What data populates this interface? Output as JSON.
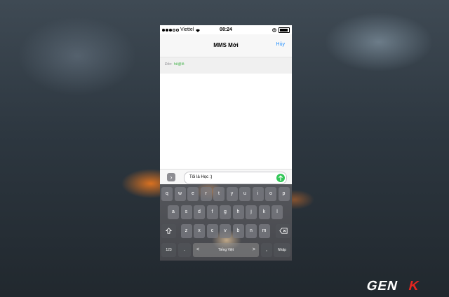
{
  "status_bar": {
    "carrier": "Viettel",
    "time": "08:24"
  },
  "nav": {
    "title": "MMS Mới",
    "cancel_label": "Hủy"
  },
  "recipient": {
    "label": "Đến:",
    "value": "hê@lô"
  },
  "message": {
    "text": "Tôi là Học :)"
  },
  "keyboard": {
    "row1": [
      "q",
      "w",
      "e",
      "r",
      "t",
      "y",
      "u",
      "i",
      "o",
      "p"
    ],
    "row2": [
      "a",
      "s",
      "d",
      "f",
      "g",
      "h",
      "j",
      "k",
      "l"
    ],
    "row3": [
      "z",
      "x",
      "c",
      "v",
      "b",
      "n",
      "m"
    ],
    "numbers_label": "123",
    "dot_label": ".",
    "prev_label": "<",
    "space_label": "Tiếng Việt",
    "next_label": ">",
    "comma_label": ",",
    "return_label": "Nhập"
  },
  "icons": {
    "wifi": "wifi-icon",
    "battery": "battery-icon",
    "alarm": "alarm-icon",
    "expand": "chevron-right-icon",
    "send": "arrow-up-icon",
    "shift": "shift-icon",
    "backspace": "backspace-icon"
  },
  "colors": {
    "accent": "#1a8cff",
    "recipient": "#3cb043",
    "send": "#34c759"
  }
}
